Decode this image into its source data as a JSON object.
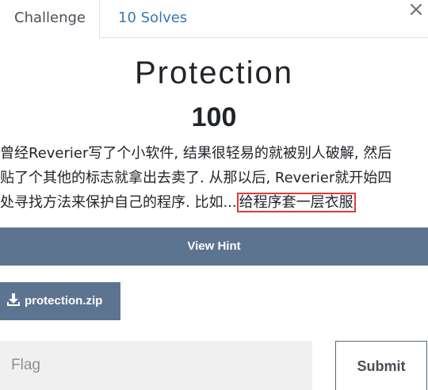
{
  "tabs": {
    "challenge_label": "Challenge",
    "solves_label": "10 Solves"
  },
  "close_glyph": "×",
  "challenge": {
    "name": "Protection",
    "value": "100",
    "description": {
      "line1": "曾经Reverier写了个小软件, 结果很轻易的就被别人破解, 然后",
      "line2": "贴了个其他的标志就拿出去卖了. 从那以后, Reverier就开始四",
      "line3_pre": "处寻找方法来保护自己的程序. 比如...",
      "line3_highlight": "给程序套一层衣服"
    }
  },
  "hint_button_label": "View Hint",
  "file": {
    "name": "protection.zip",
    "icon": "download-icon"
  },
  "flag_input": {
    "placeholder": "Flag",
    "value": ""
  },
  "submit_label": "Submit",
  "colors": {
    "button_bg": "#5c7490",
    "tab_link": "#337ab7",
    "highlight_border": "#e53935",
    "input_bg": "#f0f0f0"
  }
}
